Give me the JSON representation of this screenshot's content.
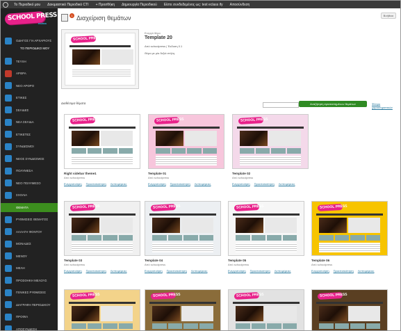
{
  "admin_bar": {
    "items": [
      "Το Περιοδικό μου",
      "Δοκιμαστικό Περιοδικό CTI",
      "+ Προσθήκη",
      "Δημιουργία Περιοδικού",
      "Είστε συνδεδεμένος ως: test eclass ify",
      "Αποσύνδεση"
    ]
  },
  "logo": {
    "text": "SCHOOL PRESS",
    "sub": "eclass"
  },
  "sidebar": {
    "items": [
      {
        "label": "ΟΔΗΓΟΣ ΓΙΑ ΑΡΧΑΡΙΟΥΣ",
        "color": "#2a83c6"
      },
      {
        "label": "ΤΕΥΧΗ",
        "color": "#2a83c6"
      },
      {
        "label": "ΑΡΘΡΑ",
        "color": "#c0392b"
      },
      {
        "label": "ΝΕΟ ΑΡΘΡΟ",
        "color": "#2a83c6"
      },
      {
        "label": "ΕΤΙΚΕΣ",
        "color": "#2a83c6"
      },
      {
        "label": "ΣΕΛΙΔΕΣ",
        "color": "#2a83c6"
      },
      {
        "label": "ΝΕΑ ΣΕΛΙΔΑ",
        "color": "#2a83c6"
      },
      {
        "label": "ΕΤΙΚΕΤΕΣ",
        "color": "#2a83c6"
      },
      {
        "label": "ΣΥΝΔΕΣΜΟΙ",
        "color": "#2a83c6"
      },
      {
        "label": "ΝΕΟΣ ΣΥΝΔΕΣΜΟΣ",
        "color": "#2a83c6"
      },
      {
        "label": "ΠΟΛΥΜΕΣΑ",
        "color": "#2a83c6"
      },
      {
        "label": "ΝΕΟ ΠΟΛΥΜΕΣΟ",
        "color": "#2a83c6"
      },
      {
        "label": "ΣΧΟΛΙΑ",
        "color": "#2a83c6"
      },
      {
        "label": "ΘΕΜΑΤΑ",
        "color": "#3c8e1e"
      },
      {
        "label": "ΡΥΘΜΙΣΕΙΣ ΘΕΜΑΤΟΣ",
        "color": "#2a83c6"
      },
      {
        "label": "ΑΛΛΑΓΗ ΦΟΝΤΟΥ",
        "color": "#2a83c6"
      },
      {
        "label": "ΜΟΝΑΔΕΣ",
        "color": "#2a83c6"
      },
      {
        "label": "ΜΕΝΟΥ",
        "color": "#2a83c6"
      },
      {
        "label": "ΜΕΛΗ",
        "color": "#2a83c6"
      },
      {
        "label": "ΠΡΟΣΘΗΚΗ ΜΕΛΟΥΣ",
        "color": "#2a83c6"
      },
      {
        "label": "ΓΕΝΙΚΕΣ ΡΥΘΜΙΣΕΙΣ",
        "color": "#2a83c6"
      },
      {
        "label": "ΔΙΑΓΡΑΦΗ ΠΕΡΙΟΔΙΚΟΥ",
        "color": "#2a83c6"
      },
      {
        "label": "ΠΡΟΦΙΛ",
        "color": "#2a83c6"
      },
      {
        "label": "ΑΠΟΣΥΝΔΕΣΗ",
        "color": "#2a83c6"
      }
    ],
    "sub_item": "ΤΟ ΠΕΡΙΟΔΙΚΟ ΜΟΥ",
    "active_index": 13
  },
  "page": {
    "title": "Διαχείριση θεμάτων",
    "badge": "1",
    "help": "Βοήθεια"
  },
  "current_theme": {
    "small_label": "Ενεργό θέμα",
    "name": "Template 20",
    "author": "Από schoolpress",
    "version": "Έκδοση 0.1",
    "description": "Θέμα με μία δεξιά στήλη."
  },
  "available": {
    "heading": "Διαθέσιμα θέματα",
    "search_button": "Αναζήτηση εγκατεστημένων θεμάτων",
    "feature_link": "Φίλτρο χαρακτηριστικών"
  },
  "themes": [
    {
      "name": "Right sidebar theme1",
      "author": "Από schoolpress",
      "bg": "#ffffff",
      "accent": "#e8218a"
    },
    {
      "name": "Template 01",
      "author": "Από schoolpress",
      "bg": "#f7c6dc",
      "accent": "#e8218a"
    },
    {
      "name": "Template 02",
      "author": "Από schoolpress",
      "bg": "#f4d9ea",
      "accent": "#e8218a"
    },
    {
      "name": "Template 03",
      "author": "Από schoolpress",
      "bg": "#f0f0f0",
      "accent": "#e8218a"
    },
    {
      "name": "Template 04",
      "author": "Από schoolpress",
      "bg": "#eceff2",
      "accent": "#e8218a"
    },
    {
      "name": "Template 05",
      "author": "Από schoolpress",
      "bg": "#f6f6f6",
      "accent": "#e8218a"
    },
    {
      "name": "Template 06",
      "author": "Από schoolpress",
      "bg": "#f7c400",
      "accent": "#e8218a"
    },
    {
      "name": "",
      "author": "",
      "bg": "#f3d38a",
      "accent": "#e8218a"
    },
    {
      "name": "",
      "author": "",
      "bg": "#8a6c3a",
      "accent": "#e8218a"
    },
    {
      "name": "",
      "author": "",
      "bg": "#e2e2e2",
      "accent": "#e8218a"
    },
    {
      "name": "",
      "author": "",
      "bg": "#5a3f22",
      "accent": "#e8218a"
    }
  ],
  "theme_actions": [
    "Ενεργοποίηση",
    "Προεπισκόπηση",
    "Λεπτομέρειες"
  ]
}
